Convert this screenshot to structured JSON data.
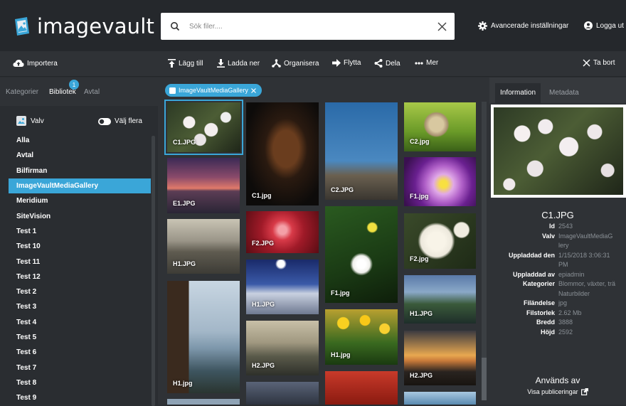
{
  "app": {
    "logo_text": "imagevault",
    "search_placeholder": "Sök filer....",
    "advanced_settings": "Avancerade inställningar",
    "logout": "Logga ut"
  },
  "toolbar": {
    "import": "Importera",
    "add": "Lägg till",
    "download": "Ladda ner",
    "organize": "Organisera",
    "move": "Flytta",
    "share": "Dela",
    "more": "Mer",
    "remove": "Ta bort"
  },
  "left": {
    "tabs": [
      "Kategorier",
      "Bibliotek",
      "Avtal"
    ],
    "badge_count": "1",
    "vault_label": "Valv",
    "multi_select_label": "Välj flera",
    "items": [
      "Alla",
      "Avtal",
      "Bilfirman",
      "ImageVaultMediaGallery",
      "Meridium",
      "SiteVision",
      "Test 1",
      "Test 10",
      "Test 11",
      "Test 12",
      "Test 2",
      "Test 3",
      "Test 4",
      "Test 5",
      "Test 6",
      "Test 7",
      "Test 8",
      "Test 9"
    ],
    "active_item": "ImageVaultMediaGallery"
  },
  "center": {
    "filter_chip": "ImageVaultMediaGallery",
    "thumbnails": [
      "C1.JPG",
      "C1.jpg",
      "C2.JPG",
      "C2.jpg",
      "E1.JPG",
      "F1.jpg",
      "H1.JPG",
      "F2.JPG",
      "F2.jpg",
      "H1.JPG",
      "F1.jpg",
      "H1.JPG",
      "H1.jpg",
      "H2.JPG",
      "H1.jpg",
      "H2.JPG"
    ]
  },
  "right": {
    "tabs": [
      "Information",
      "Metadata"
    ],
    "title": "C1.JPG",
    "details": [
      {
        "k": "Id",
        "v": [
          "2543"
        ]
      },
      {
        "k": "Valv",
        "v": [
          "ImageVaultMediaG",
          "lery"
        ]
      },
      {
        "k": "Uppladdad den",
        "v": [
          "1/15/2018 3:06:31",
          "PM"
        ]
      },
      {
        "k": "Uppladdad av",
        "v": [
          "epiadmin"
        ]
      },
      {
        "k": "Kategorier",
        "v": [
          "Blommor, växter, trä",
          "Naturbilder"
        ]
      },
      {
        "k": "Filändelse",
        "v": [
          "jpg"
        ]
      },
      {
        "k": "Filstorlek",
        "v": [
          "2.62 Mb"
        ]
      },
      {
        "k": "Bredd",
        "v": [
          "3888"
        ]
      },
      {
        "k": "Höjd",
        "v": [
          "2592"
        ]
      }
    ],
    "used_title": "Används av",
    "show_publications": "Visa publiceringar"
  },
  "colors": {
    "accent": "#3aa6d8",
    "bg": "#2a2d31",
    "panel": "#2f3236"
  }
}
